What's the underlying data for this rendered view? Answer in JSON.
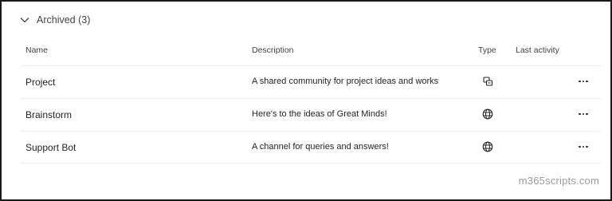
{
  "section": {
    "title": "Archived (3)",
    "icon": "chevron-down-icon"
  },
  "columns": {
    "name": "Name",
    "description": "Description",
    "type": "Type",
    "last_activity": "Last activity"
  },
  "rows": [
    {
      "name": "Project",
      "description": "A shared community for project ideas and works",
      "type_icon": "shared-channel-icon",
      "last_activity": ""
    },
    {
      "name": "Brainstorm",
      "description": "Here's to the ideas of Great Minds!",
      "type_icon": "globe-icon",
      "last_activity": ""
    },
    {
      "name": "Support Bot",
      "description": "A channel for queries and answers!",
      "type_icon": "globe-icon",
      "last_activity": ""
    }
  ],
  "watermark": "m365scripts.com"
}
